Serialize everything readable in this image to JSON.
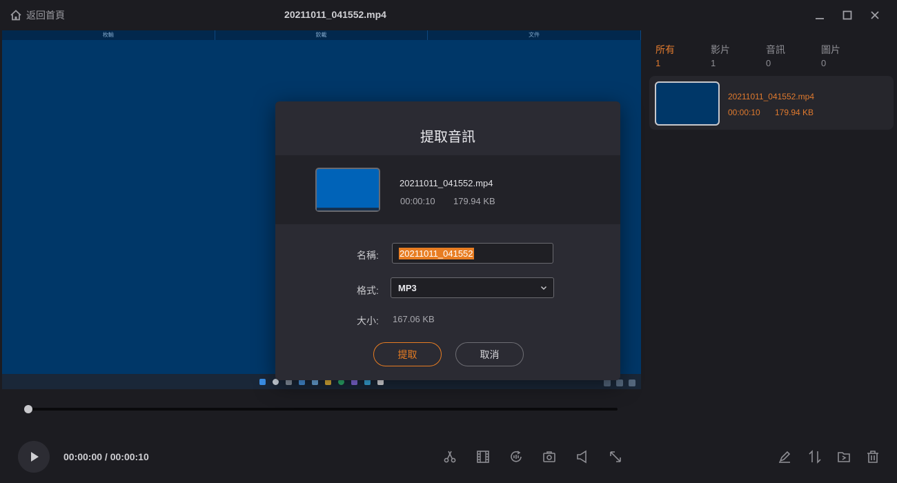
{
  "titlebar": {
    "home_label": "返回首頁",
    "file_name": "20211011_041552.mp4"
  },
  "video": {
    "tabs": [
      "枚輸",
      "欽載",
      "文件"
    ]
  },
  "player": {
    "time": "00:00:00 / 00:00:10",
    "progress": 0
  },
  "panel": {
    "filters": [
      {
        "label": "所有",
        "count": "1"
      },
      {
        "label": "影片",
        "count": "1"
      },
      {
        "label": "音訊",
        "count": "0"
      },
      {
        "label": "圖片",
        "count": "0"
      }
    ],
    "media": {
      "name": "20211011_041552.mp4",
      "duration": "00:00:10",
      "size": "179.94 KB"
    }
  },
  "dialog": {
    "title": "提取音訊",
    "file": {
      "name": "20211011_041552.mp4",
      "duration": "00:00:10",
      "size": "179.94 KB"
    },
    "name_label": "名稱:",
    "name_value": "20211011_041552",
    "format_label": "格式:",
    "format_value": "MP3",
    "size_label": "大小:",
    "size_value": "167.06 KB",
    "extract_label": "提取",
    "cancel_label": "取消"
  },
  "colors": {
    "accent": "#e87d22",
    "background": "#1c1c21",
    "dialog": "#2b2b33",
    "video": "#003768"
  }
}
